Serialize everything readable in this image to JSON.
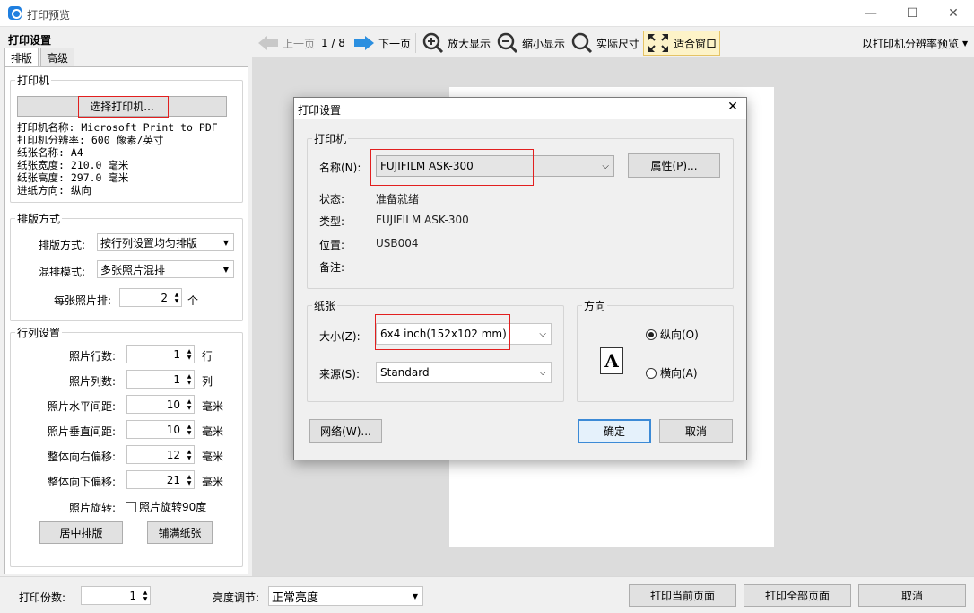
{
  "window": {
    "title": "打印预览",
    "minimize": "—",
    "maximize": "☐",
    "close": "✕"
  },
  "left": {
    "title": "打印设置",
    "tabs": [
      "排版",
      "高级"
    ],
    "printer_group": {
      "legend": "打印机",
      "select_button": "选择打印机...",
      "info": [
        "打印机名称: Microsoft Print to PDF",
        "打印机分辨率: 600 像素/英寸",
        "纸张名称: A4",
        "纸张宽度: 210.0 毫米",
        "纸张高度: 297.0 毫米",
        "进纸方向: 纵向"
      ]
    },
    "layout_group": {
      "legend": "排版方式",
      "mode_label": "排版方式:",
      "mode_value": "按行列设置均匀排版",
      "mix_label": "混排模式:",
      "mix_value": "多张照片混排",
      "per_label": "每张照片排:",
      "per_value": "2",
      "per_unit": "个"
    },
    "grid_group": {
      "legend": "行列设置",
      "rows": [
        {
          "label": "照片行数:",
          "value": "1",
          "unit": "行"
        },
        {
          "label": "照片列数:",
          "value": "1",
          "unit": "列"
        },
        {
          "label": "照片水平间距:",
          "value": "10",
          "unit": "毫米"
        },
        {
          "label": "照片垂直间距:",
          "value": "10",
          "unit": "毫米"
        },
        {
          "label": "整体向右偏移:",
          "value": "12",
          "unit": "毫米"
        },
        {
          "label": "整体向下偏移:",
          "value": "21",
          "unit": "毫米"
        }
      ],
      "rotate_label": "照片旋转:",
      "rotate_checkbox": "照片旋转90度",
      "center_button": "居中排版",
      "fill_button": "铺满纸张"
    }
  },
  "toolbar": {
    "prev": "上一页",
    "page": "1 / 8",
    "next": "下一页",
    "zoom_in": "放大显示",
    "zoom_out": "缩小显示",
    "actual": "实际尺寸",
    "fit": "适合窗口",
    "mode": "以打印机分辨率预览"
  },
  "bottom": {
    "copies_label": "打印份数:",
    "copies_value": "1",
    "brightness_label": "亮度调节:",
    "brightness_value": "正常亮度",
    "print_current": "打印当前页面",
    "print_all": "打印全部页面",
    "cancel": "取消"
  },
  "dialog": {
    "title": "打印设置",
    "close": "✕",
    "printer_legend": "打印机",
    "name_label": "名称(N):",
    "name_value": "FUJIFILM ASK-300",
    "properties_button": "属性(P)...",
    "status_label": "状态:",
    "status_value": "准备就绪",
    "type_label": "类型:",
    "type_value": "FUJIFILM ASK-300",
    "where_label": "位置:",
    "where_value": "USB004",
    "comment_label": "备注:",
    "paper_legend": "纸张",
    "size_label": "大小(Z):",
    "size_value": "6x4 inch(152x102 mm)",
    "source_label": "来源(S):",
    "source_value": "Standard",
    "orientation_legend": "方向",
    "portrait": "纵向(O)",
    "landscape": "横向(A)",
    "orientation_glyph": "A",
    "network_button": "网络(W)...",
    "ok_button": "确定",
    "cancel_button": "取消"
  },
  "colors": {
    "highlight": "#e21f1f",
    "accent": "#1f7fe0",
    "preview_bg": "#dcdcdc"
  }
}
